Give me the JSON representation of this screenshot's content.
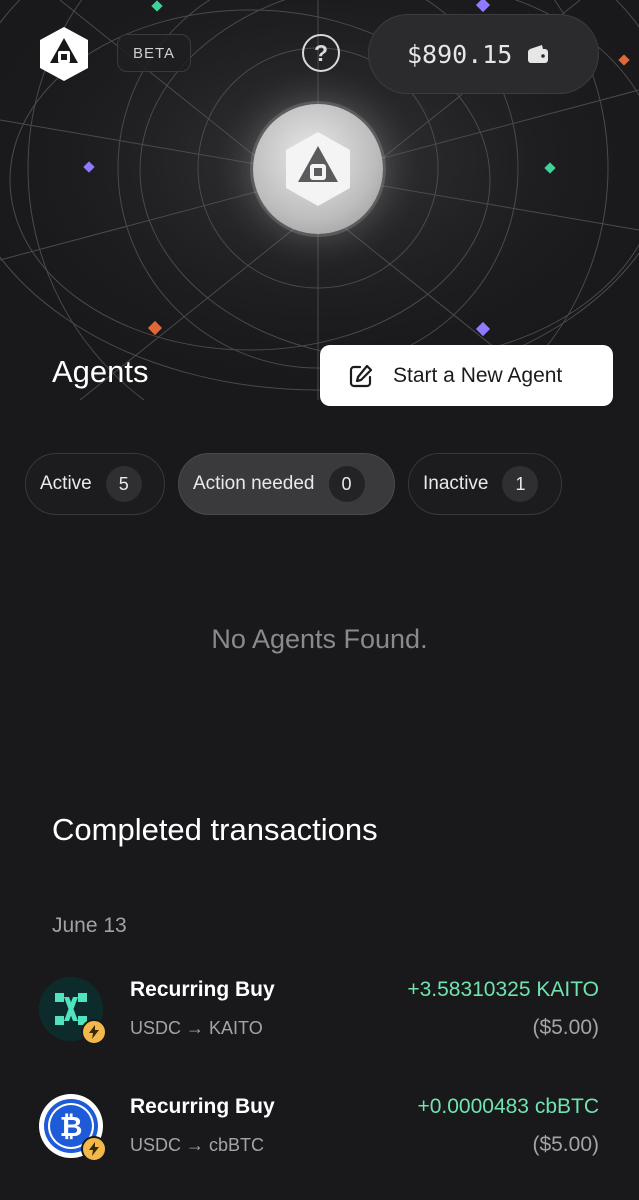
{
  "header": {
    "beta_label": "BETA",
    "help_label": "?",
    "wallet_balance": "$890.15"
  },
  "agents": {
    "title": "Agents",
    "new_agent_label": "Start a New Agent",
    "filters": [
      {
        "label": "Active",
        "count": "5",
        "selected": false
      },
      {
        "label": "Action needed",
        "count": "0",
        "selected": true
      },
      {
        "label": "Inactive",
        "count": "1",
        "selected": false
      }
    ],
    "empty_message": "No Agents Found."
  },
  "transactions": {
    "title": "Completed transactions",
    "groups": [
      {
        "date": "June 13",
        "items": [
          {
            "title": "Recurring Buy",
            "pair": "USDC → KAITO",
            "amount": "+3.58310325 KAITO",
            "usd": "($5.00)",
            "icon": "kaito-token-icon"
          },
          {
            "title": "Recurring Buy",
            "pair": "USDC → cbBTC",
            "amount": "+0.0000483 cbBTC",
            "usd": "($5.00)",
            "icon": "cbbtc-token-icon"
          }
        ]
      }
    ]
  },
  "colors": {
    "background": "#19191b",
    "positive": "#6fe3b0",
    "badge": "#f2b84b",
    "bitcoin_blue": "#1e5bd8"
  }
}
